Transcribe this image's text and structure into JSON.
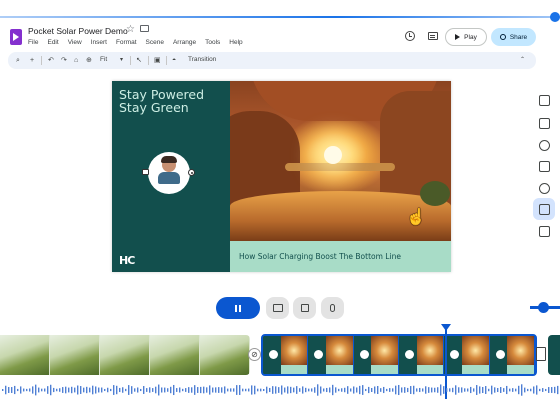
{
  "document": {
    "title": "Pocket Solar Power Demo",
    "menu": [
      "File",
      "Edit",
      "View",
      "Insert",
      "Format",
      "Scene",
      "Arrange",
      "Tools",
      "Help"
    ]
  },
  "header_actions": {
    "play_label": "Play",
    "share_label": "Share"
  },
  "toolbar": {
    "zoom_value": "Fit",
    "transition_label": "Transition"
  },
  "slide": {
    "heading_line1": "Stay Powered",
    "heading_line2": "Stay Green",
    "logo_text": "HC",
    "caption": "How Solar Charging Boost The Bottom Line"
  },
  "colors": {
    "slide_dark": "#124f4d",
    "slide_mint": "#a8dcc7",
    "accent_blue": "#0b57d0",
    "share_bg": "#c2e7ff"
  }
}
